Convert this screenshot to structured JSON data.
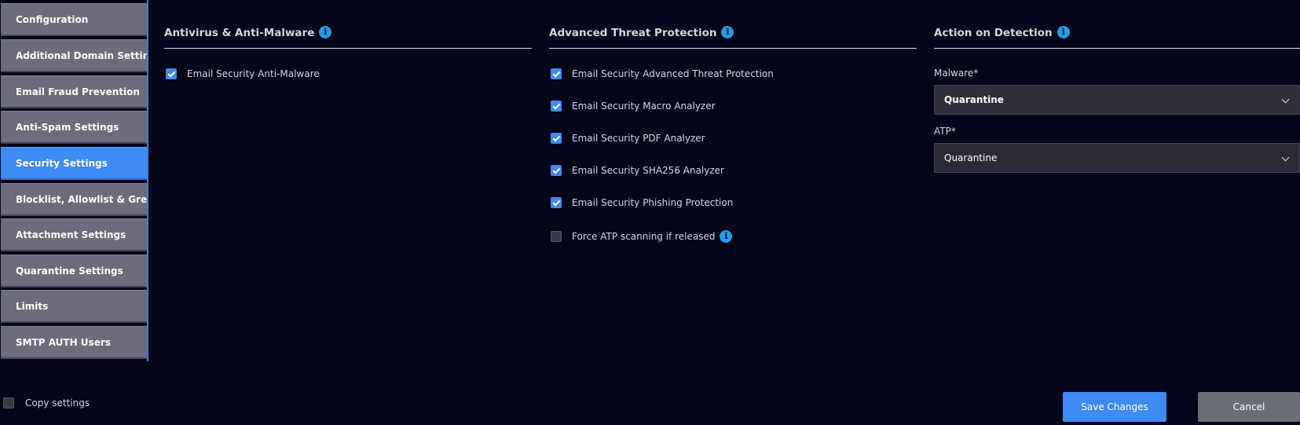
{
  "sidebar": {
    "items": [
      {
        "label": "Configuration",
        "active": false
      },
      {
        "label": "Additional Domain Settings",
        "active": false
      },
      {
        "label": "Email Fraud Prevention",
        "active": false
      },
      {
        "label": "Anti-Spam Settings",
        "active": false
      },
      {
        "label": "Security Settings",
        "active": true
      },
      {
        "label": "Blocklist, Allowlist & Greylist",
        "active": false
      },
      {
        "label": "Attachment Settings",
        "active": false
      },
      {
        "label": "Quarantine Settings",
        "active": false
      },
      {
        "label": "Limits",
        "active": false
      },
      {
        "label": "SMTP AUTH Users",
        "active": false
      }
    ]
  },
  "antivirus": {
    "title": "Antivirus & Anti-Malware",
    "options": [
      {
        "label": "Email Security Anti-Malware",
        "checked": true
      }
    ]
  },
  "atp": {
    "title": "Advanced Threat Protection",
    "options": [
      {
        "label": "Email Security Advanced Threat Protection",
        "checked": true
      },
      {
        "label": "Email Security Macro Analyzer",
        "checked": true
      },
      {
        "label": "Email Security PDF Analyzer",
        "checked": true
      },
      {
        "label": "Email Security SHA256 Analyzer",
        "checked": true
      },
      {
        "label": "Email Security Phishing Protection",
        "checked": true
      },
      {
        "label": "Force ATP scanning if released",
        "checked": false
      }
    ]
  },
  "action": {
    "title": "Action on Detection",
    "malware_label": "Malware*",
    "malware_value": "Quarantine",
    "atp_label": "ATP*",
    "atp_value": "Quarantine"
  },
  "footer": {
    "copy_label": "Copy settings",
    "copy_checked": false,
    "save_label": "Save Changes",
    "cancel_label": "Cancel"
  },
  "icons": {
    "info": "info-icon",
    "chevron": "chevron-down-icon",
    "check": "checkmark-icon"
  },
  "colors": {
    "background": "#05061a",
    "accent": "#3f8af3",
    "sidebar_item": "#6d6c7c",
    "info": "#1f9ee0",
    "cancel": "#6a6f77"
  }
}
